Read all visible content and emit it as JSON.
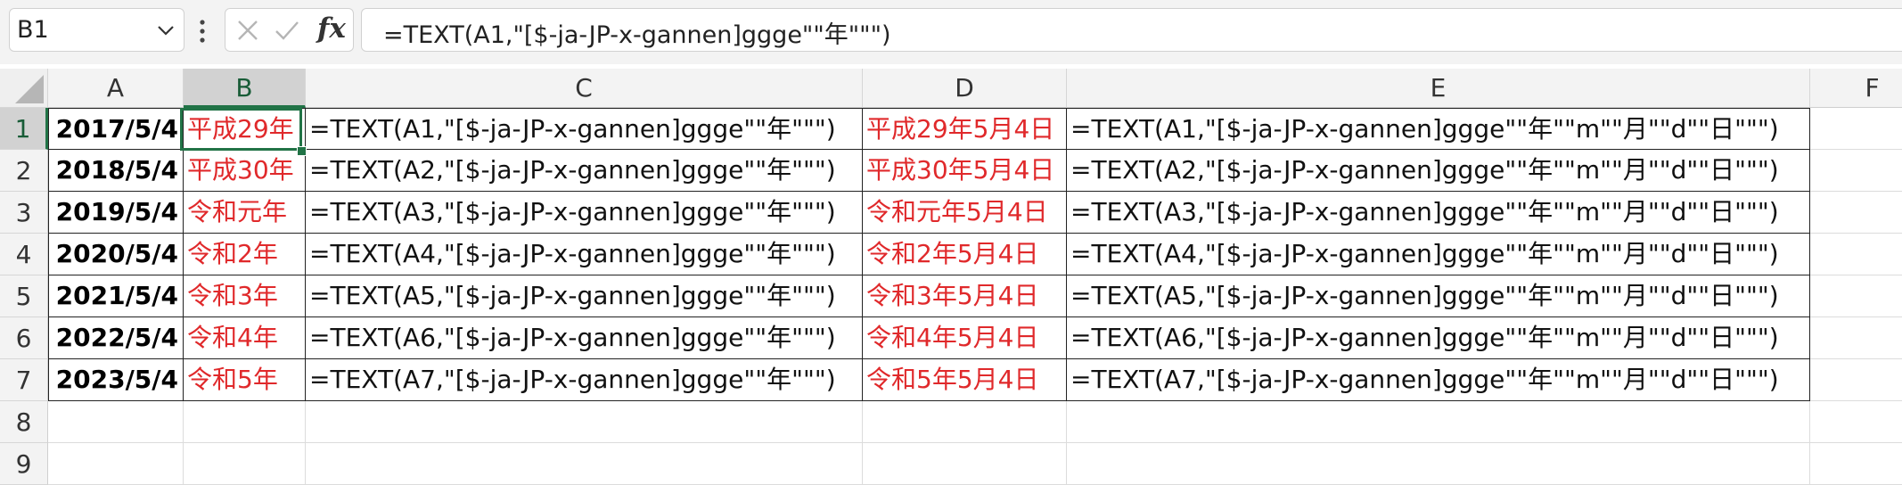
{
  "formula_bar": {
    "name_box": "B1",
    "formula": "=TEXT(A1,\"[$-ja-JP-x-gannen]ggge\"\"年\"\"\")",
    "fx_label": "fx"
  },
  "columns": [
    "A",
    "B",
    "C",
    "D",
    "E",
    "F"
  ],
  "rows": [
    "1",
    "2",
    "3",
    "4",
    "5",
    "6",
    "7",
    "8",
    "9"
  ],
  "selected_cell": "B1",
  "colors": {
    "accent": "#217346",
    "red_text": "#e0292b"
  },
  "cells": [
    {
      "A": "2017/5/4",
      "B": "平成29年",
      "C": "=TEXT(A1,\"[$-ja-JP-x-gannen]ggge\"\"年\"\"\")",
      "D": "平成29年5月4日",
      "E": "=TEXT(A1,\"[$-ja-JP-x-gannen]ggge\"\"年\"\"m\"\"月\"\"d\"\"日\"\"\")"
    },
    {
      "A": "2018/5/4",
      "B": "平成30年",
      "C": "=TEXT(A2,\"[$-ja-JP-x-gannen]ggge\"\"年\"\"\")",
      "D": "平成30年5月4日",
      "E": "=TEXT(A2,\"[$-ja-JP-x-gannen]ggge\"\"年\"\"m\"\"月\"\"d\"\"日\"\"\")"
    },
    {
      "A": "2019/5/4",
      "B": "令和元年",
      "C": "=TEXT(A3,\"[$-ja-JP-x-gannen]ggge\"\"年\"\"\")",
      "D": "令和元年5月4日",
      "E": "=TEXT(A3,\"[$-ja-JP-x-gannen]ggge\"\"年\"\"m\"\"月\"\"d\"\"日\"\"\")"
    },
    {
      "A": "2020/5/4",
      "B": "令和2年",
      "C": "=TEXT(A4,\"[$-ja-JP-x-gannen]ggge\"\"年\"\"\")",
      "D": "令和2年5月4日",
      "E": "=TEXT(A4,\"[$-ja-JP-x-gannen]ggge\"\"年\"\"m\"\"月\"\"d\"\"日\"\"\")"
    },
    {
      "A": "2021/5/4",
      "B": "令和3年",
      "C": "=TEXT(A5,\"[$-ja-JP-x-gannen]ggge\"\"年\"\"\")",
      "D": "令和3年5月4日",
      "E": "=TEXT(A5,\"[$-ja-JP-x-gannen]ggge\"\"年\"\"m\"\"月\"\"d\"\"日\"\"\")"
    },
    {
      "A": "2022/5/4",
      "B": "令和4年",
      "C": "=TEXT(A6,\"[$-ja-JP-x-gannen]ggge\"\"年\"\"\")",
      "D": "令和4年5月4日",
      "E": "=TEXT(A6,\"[$-ja-JP-x-gannen]ggge\"\"年\"\"m\"\"月\"\"d\"\"日\"\"\")"
    },
    {
      "A": "2023/5/4",
      "B": "令和5年",
      "C": "=TEXT(A7,\"[$-ja-JP-x-gannen]ggge\"\"年\"\"\")",
      "D": "令和5年5月4日",
      "E": "=TEXT(A7,\"[$-ja-JP-x-gannen]ggge\"\"年\"\"m\"\"月\"\"d\"\"日\"\"\")"
    }
  ]
}
